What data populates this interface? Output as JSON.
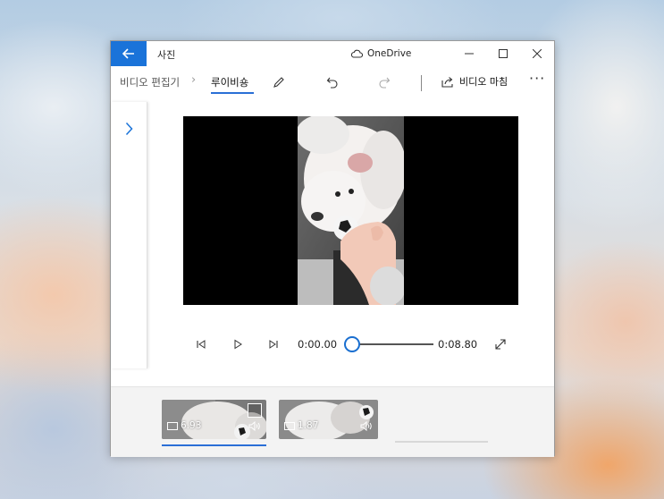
{
  "window": {
    "app_title": "사진",
    "onedrive_label": "OneDrive"
  },
  "toolbar": {
    "breadcrumb_root": "비디오 편집기",
    "breadcrumb_current": "루이비숑",
    "finish_label": "비디오 마침",
    "more_label": "···"
  },
  "player": {
    "current_time": "0:00.00",
    "total_time": "0:08.80",
    "progress": 0
  },
  "clips": [
    {
      "duration": "6.93",
      "selected": true
    },
    {
      "duration": "1.87",
      "selected": false
    }
  ],
  "colors": {
    "accent": "#1a73d9",
    "underline": "#2a6fd6"
  }
}
